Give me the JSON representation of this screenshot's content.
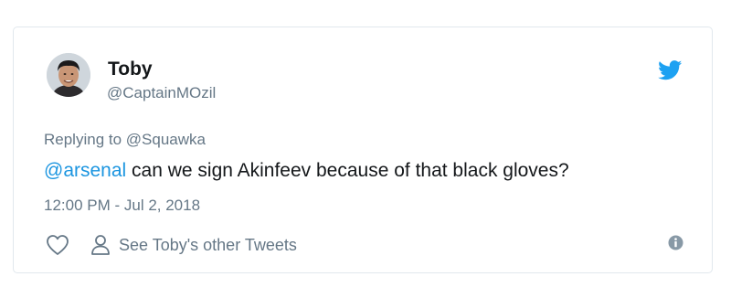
{
  "tweet": {
    "author": {
      "name": "Toby",
      "handle": "@CaptainMOzil"
    },
    "replying_to": "Replying to @Squawka",
    "text": {
      "mention": "@arsenal",
      "body": " can we sign Akinfeev because of that black gloves?"
    },
    "timestamp": "12:00 PM - Jul 2, 2018",
    "actions": {
      "other_tweets_label": "See Toby's other Tweets"
    }
  },
  "colors": {
    "brand_blue": "#1da1f2",
    "mention_blue": "#1b95e0",
    "secondary_text": "#657786",
    "primary_text": "#14171a",
    "border": "#e1e8ed"
  },
  "icons": [
    "twitter-bird-icon",
    "heart-icon",
    "person-icon",
    "info-icon"
  ]
}
